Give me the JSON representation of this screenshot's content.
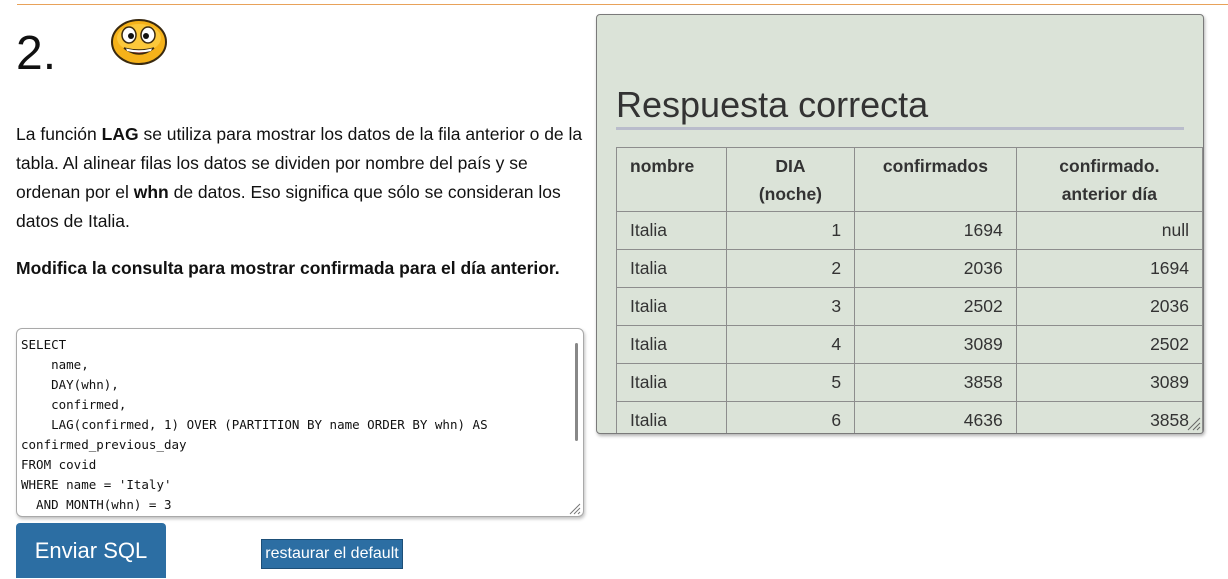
{
  "question": {
    "number": "2.",
    "intro": {
      "p1": "La función ",
      "b1": "LAG",
      "p2": " se utiliza para mostrar los datos de la fila anterior o de la tabla. Al alinear filas los datos se dividen por nombre del país y se ordenan por el ",
      "b2": "whn",
      "p3": " de datos. Eso significa que sólo se consideran los datos de Italia."
    },
    "task": "Modifica la consulta para mostrar confirmada para el día anterior."
  },
  "editor": {
    "sql": "SELECT\n    name,\n    DAY(whn),\n    confirmed,\n    LAG(confirmed, 1) OVER (PARTITION BY name ORDER BY whn) AS\nconfirmed_previous_day\nFROM covid\nWHERE name = 'Italy'\n  AND MONTH(whn) = 3"
  },
  "buttons": {
    "submit": "Enviar SQL",
    "reset": "restaurar el default"
  },
  "answer": {
    "title": "Respuesta correcta",
    "headers": {
      "col1": "nombre",
      "col2_line1": "DIA",
      "col2_line2": "(noche)",
      "col3": "confirmados",
      "col4_line1": "confirmado.",
      "col4_line2": "anterior día"
    },
    "rows": [
      {
        "nombre": "Italia",
        "dia": "1",
        "confirmados": "1694",
        "anterior": "null"
      },
      {
        "nombre": "Italia",
        "dia": "2",
        "confirmados": "2036",
        "anterior": "1694"
      },
      {
        "nombre": "Italia",
        "dia": "3",
        "confirmados": "2502",
        "anterior": "2036"
      },
      {
        "nombre": "Italia",
        "dia": "4",
        "confirmados": "3089",
        "anterior": "2502"
      },
      {
        "nombre": "Italia",
        "dia": "5",
        "confirmados": "3858",
        "anterior": "3089"
      },
      {
        "nombre": "Italia",
        "dia": "6",
        "confirmados": "4636",
        "anterior": "3858"
      }
    ]
  },
  "colors": {
    "accent_line": "#e8a25a",
    "button_blue": "#2c6ea3",
    "answer_bg": "#dbe3d8"
  },
  "icons": {
    "smiley": "smiley-face-icon"
  }
}
